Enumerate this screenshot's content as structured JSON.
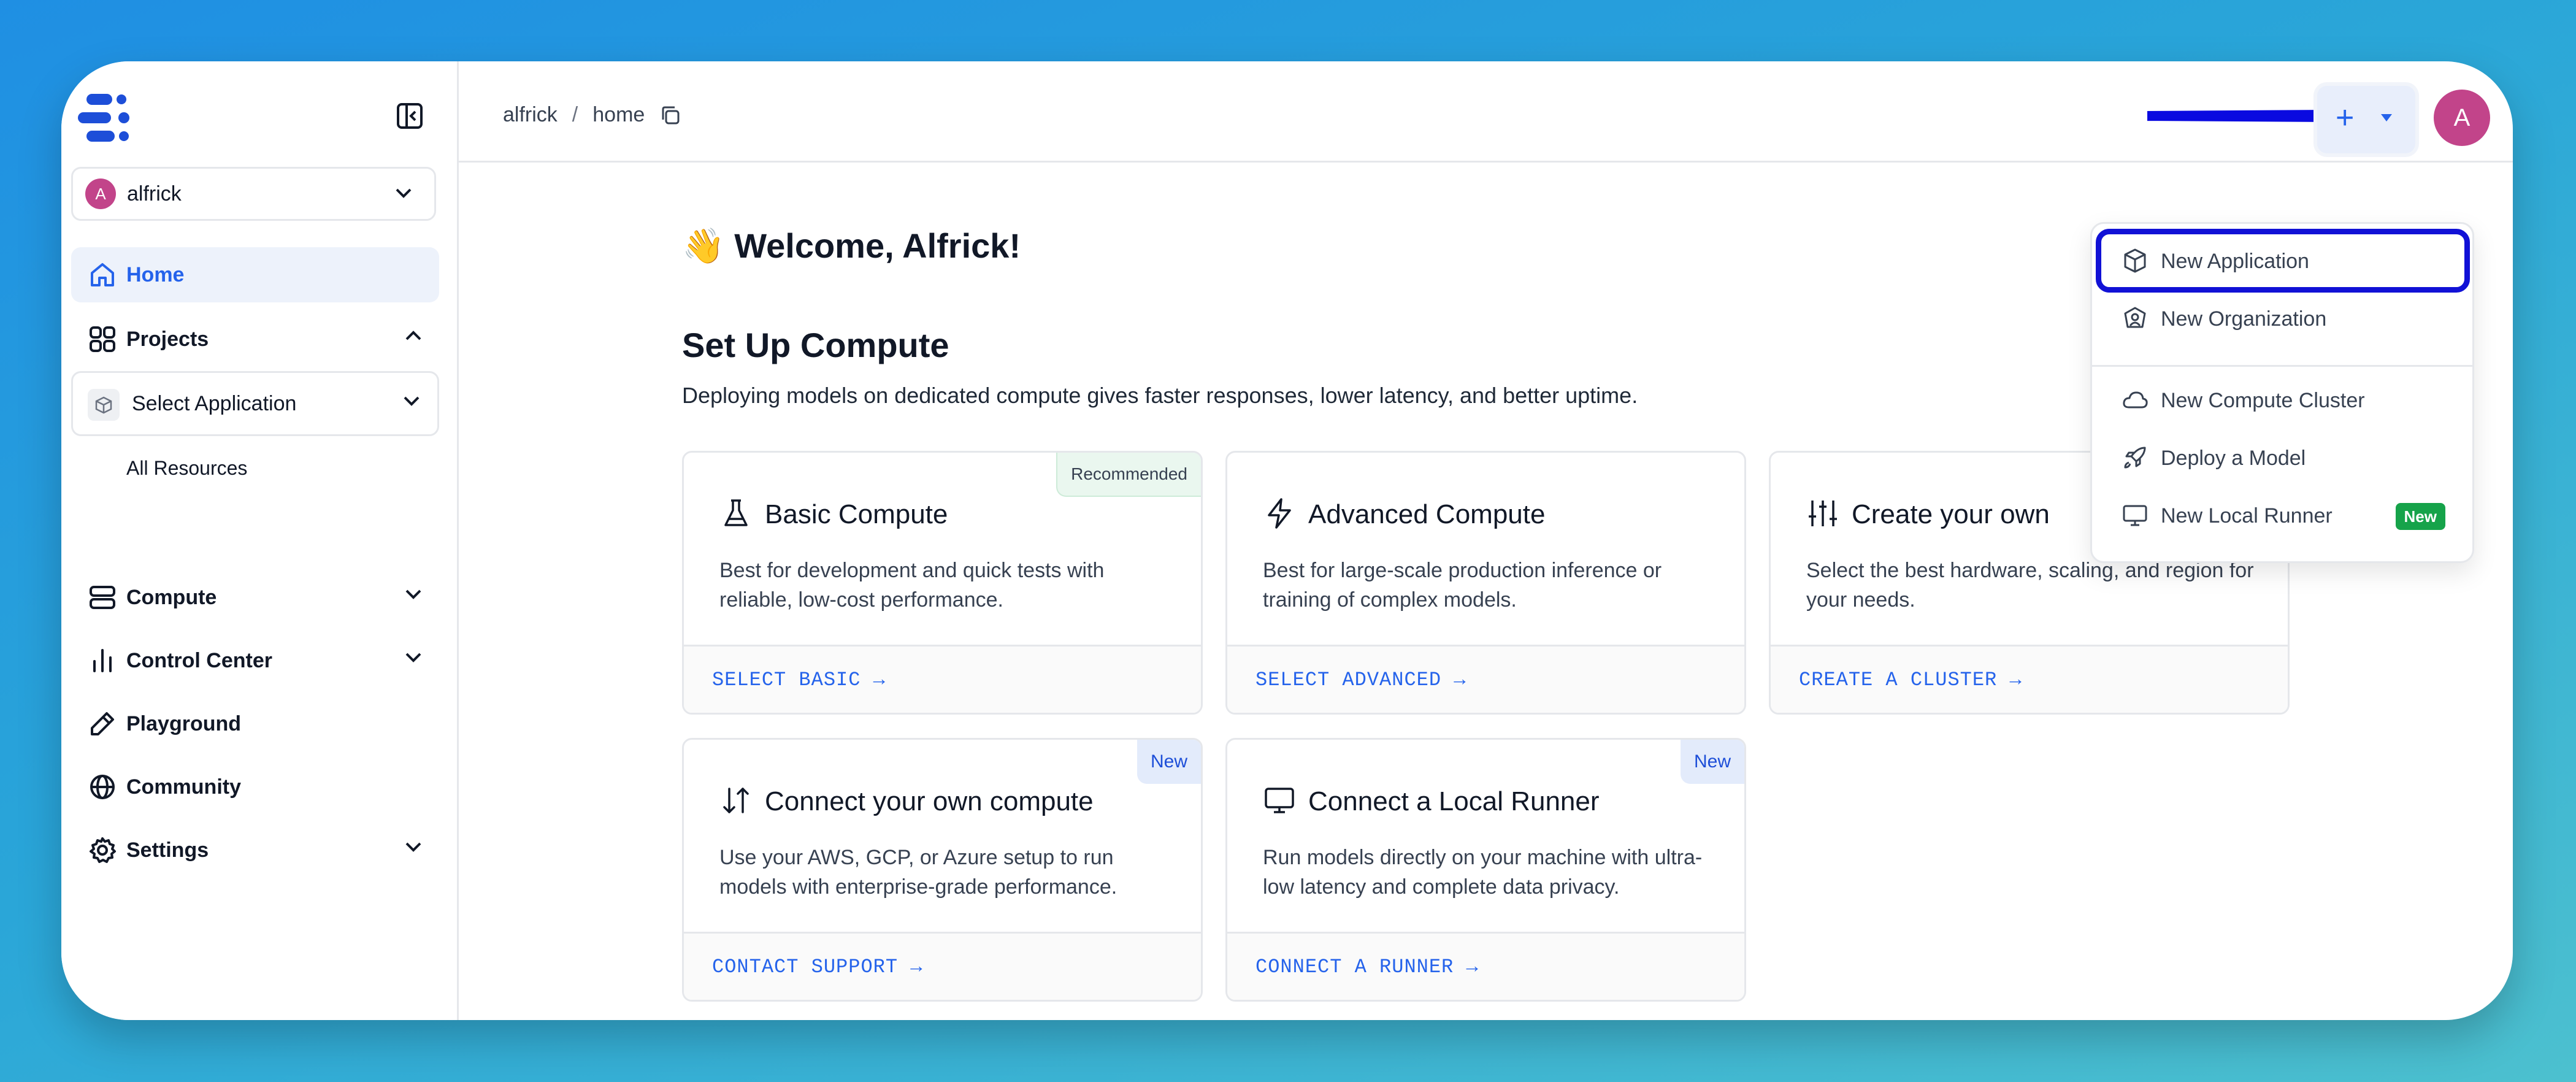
{
  "sidebar": {
    "org": {
      "avatar": "A",
      "name": "alfrick"
    },
    "nav": {
      "home": "Home",
      "projects": "Projects",
      "select_application": "Select Application",
      "all_resources": "All Resources",
      "compute": "Compute",
      "control_center": "Control Center",
      "playground": "Playground",
      "community": "Community",
      "settings": "Settings"
    }
  },
  "header": {
    "breadcrumb": {
      "org": "alfrick",
      "separator": "/",
      "page": "home"
    },
    "add_button": "+",
    "user_avatar": "A"
  },
  "main": {
    "welcome": "👋 Welcome, Alfrick!",
    "setup_title": "Set Up Compute",
    "setup_desc": "Deploying models on dedicated compute gives faster responses, lower latency, and better uptime.",
    "cards": [
      {
        "icon": "flask-icon",
        "title": "Basic Compute",
        "desc": "Best for development and quick tests with reliable, low-cost performance.",
        "action": "SELECT BASIC",
        "badge": "Recommended"
      },
      {
        "icon": "lightning-icon",
        "title": "Advanced Compute",
        "desc": "Best for large-scale production inference or training of complex models.",
        "action": "SELECT ADVANCED"
      },
      {
        "icon": "sliders-icon",
        "title": "Create your own",
        "desc": "Select the best hardware, scaling, and region for your needs.",
        "action": "CREATE A CLUSTER"
      },
      {
        "icon": "arrows-updown-icon",
        "title": "Connect your own compute",
        "desc": "Use your AWS, GCP, or Azure setup to run models with enterprise-grade performance.",
        "action": "CONTACT SUPPORT",
        "badge": "New"
      },
      {
        "icon": "monitor-icon",
        "title": "Connect a Local Runner",
        "desc": "Run models directly on your machine with ultra-low latency and complete data privacy.",
        "action": "CONNECT A RUNNER",
        "badge": "New"
      }
    ]
  },
  "dropdown": {
    "items": [
      {
        "label": "New Application",
        "icon": "cube-icon"
      },
      {
        "label": "New Organization",
        "icon": "organization-icon"
      },
      {
        "label": "New Compute Cluster",
        "icon": "cloud-icon"
      },
      {
        "label": "Deploy a Model",
        "icon": "rocket-icon"
      },
      {
        "label": "New Local Runner",
        "icon": "monitor-icon",
        "badge": "New"
      }
    ]
  },
  "colors": {
    "accent": "#2563eb",
    "avatar": "#c2448a",
    "highlight": "#1111d6",
    "new_badge": "#16a34a"
  }
}
